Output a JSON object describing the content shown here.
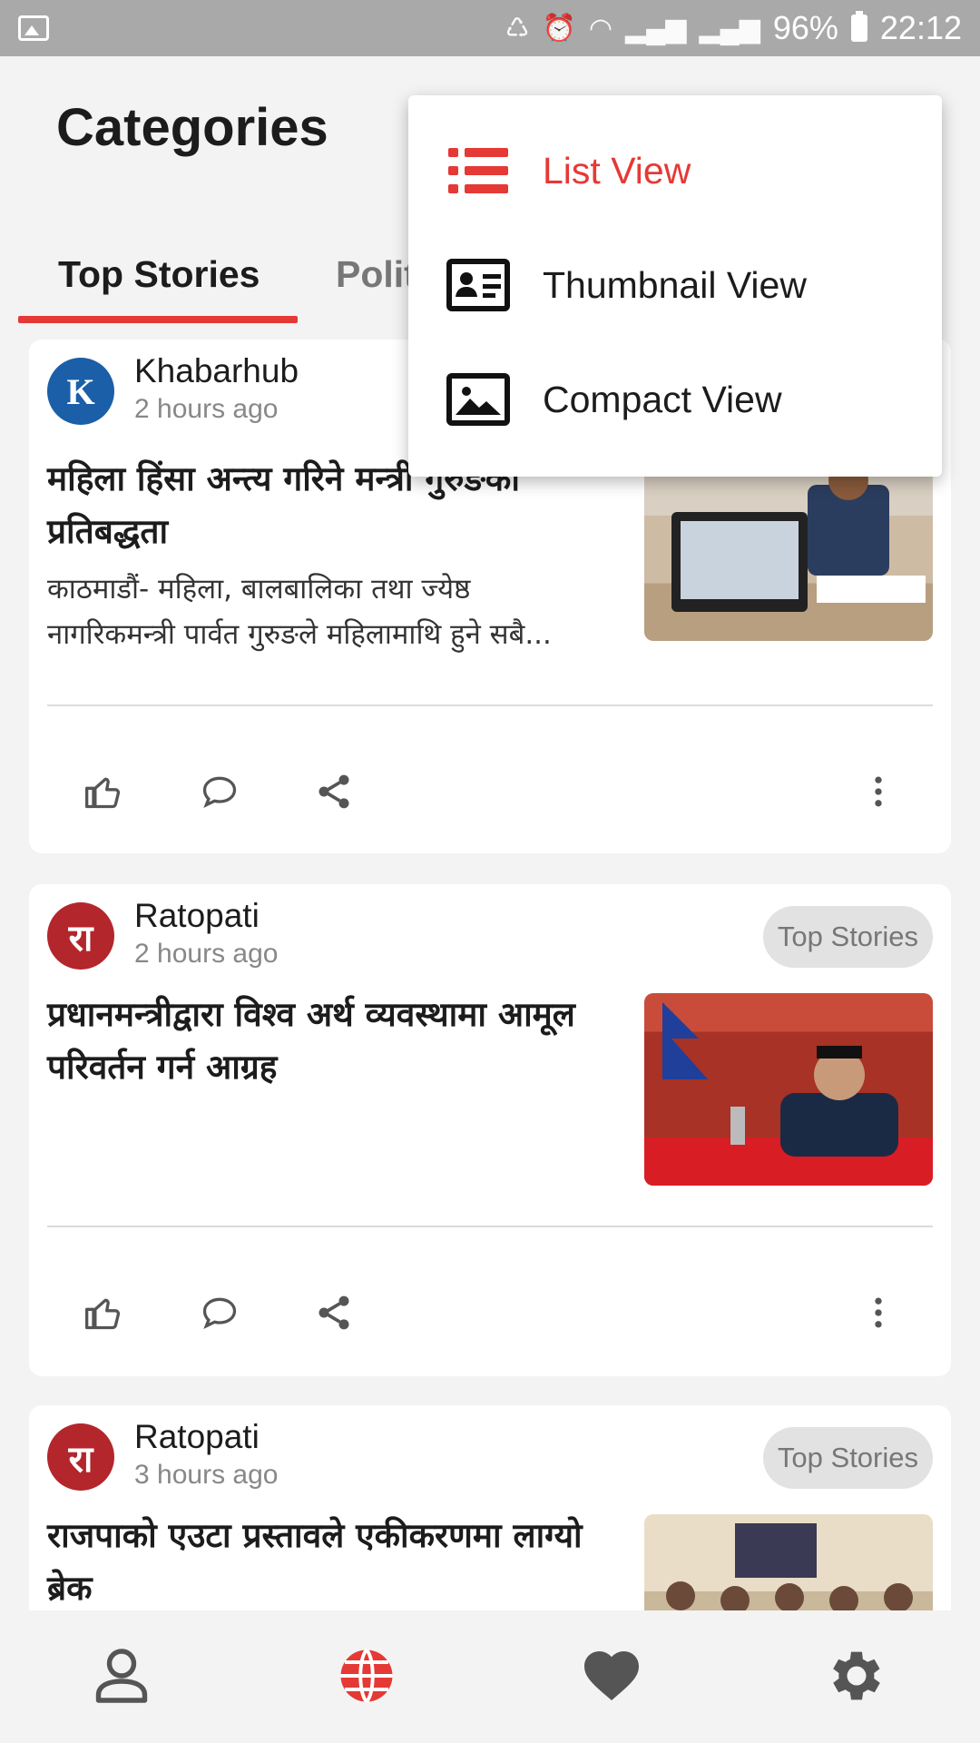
{
  "status_bar": {
    "battery": "96%",
    "time": "22:12"
  },
  "header": {
    "title": "Categories"
  },
  "tabs": [
    {
      "label": "Top Stories",
      "active": true
    },
    {
      "label": "Polit"
    }
  ],
  "menu": {
    "items": [
      {
        "label": "List View",
        "icon": "list-icon",
        "selected": true
      },
      {
        "label": "Thumbnail View",
        "icon": "id-card-icon",
        "selected": false
      },
      {
        "label": "Compact View",
        "icon": "image-icon",
        "selected": false
      }
    ]
  },
  "feed": {
    "cards": [
      {
        "source": "Khabarhub",
        "time": "2 hours ago",
        "badge": "",
        "headline": "महिला हिंसा अन्त्य गरिने मन्त्री गुरुङको प्रतिबद्धता",
        "summary_line1": "काठमाडौं- महिला, बालबालिका तथा ज्येष्ठ",
        "summary_line2": "नागरिकमन्त्री पार्वत गुरुङले महिलामाथि हुने सबै..."
      },
      {
        "source": "Ratopati",
        "time": "2 hours ago",
        "badge": "Top Stories",
        "headline": "प्रधानमन्त्रीद्वारा विश्व अर्थ व्यवस्थामा आमूल परिवर्तन गर्न आग्रह",
        "summary_line1": "",
        "summary_line2": ""
      },
      {
        "source": "Ratopati",
        "time": "3 hours ago",
        "badge": "Top Stories",
        "headline": "राजपाको एउटा प्रस्तावले एकीकरणमा लाग्यो ब्रेक",
        "summary_line1": "",
        "summary_line2": ""
      }
    ]
  },
  "colors": {
    "accent": "#e53935",
    "icon_gray": "#555555",
    "card_bg": "#ffffff",
    "page_bg": "#f3f3f3"
  }
}
